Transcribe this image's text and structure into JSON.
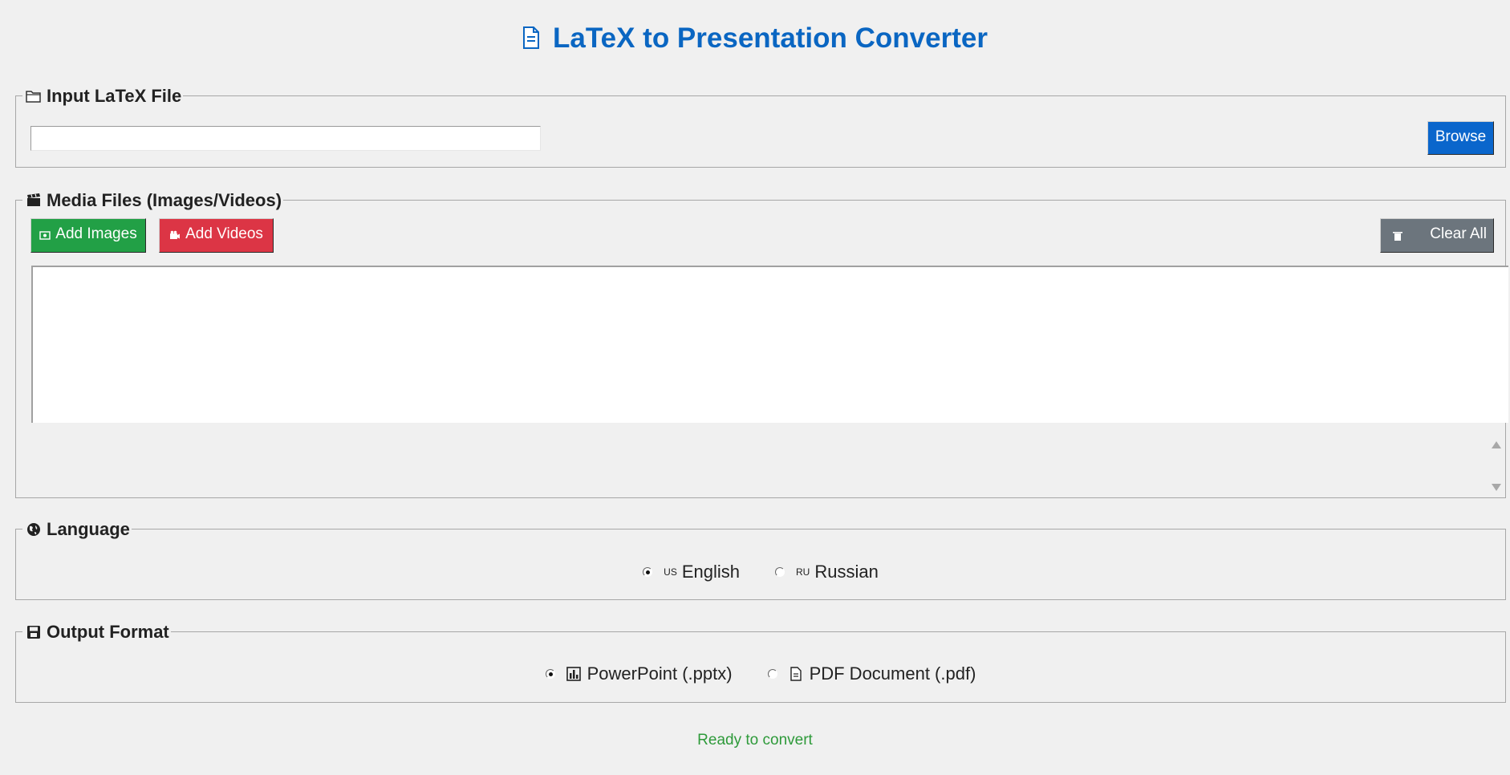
{
  "app": {
    "title": "LaTeX to Presentation Converter"
  },
  "input_section": {
    "legend": "Input LaTeX File",
    "file_path_value": "",
    "browse_label": "Browse"
  },
  "media_section": {
    "legend": "Media Files (Images/Videos)",
    "add_images_label": "Add Images",
    "add_videos_label": "Add Videos",
    "clear_all_label": "Clear All",
    "files": []
  },
  "language_section": {
    "legend": "Language",
    "options": [
      {
        "flag": "US",
        "label": "English",
        "selected": true
      },
      {
        "flag": "RU",
        "label": "Russian",
        "selected": false
      }
    ]
  },
  "output_section": {
    "legend": "Output Format",
    "options": [
      {
        "icon": "bar-chart-icon",
        "label": "PowerPoint (.pptx)",
        "selected": true
      },
      {
        "icon": "document-icon",
        "label": "PDF Document (.pdf)",
        "selected": false
      }
    ]
  },
  "status": {
    "text": "Ready to convert"
  },
  "colors": {
    "title": "#0a66c2",
    "browse_button": "#0a66cc",
    "add_images_button": "#22a046",
    "add_videos_button": "#dc3545",
    "clear_all_button": "#6c757d",
    "status_text": "#2e9a3a"
  }
}
